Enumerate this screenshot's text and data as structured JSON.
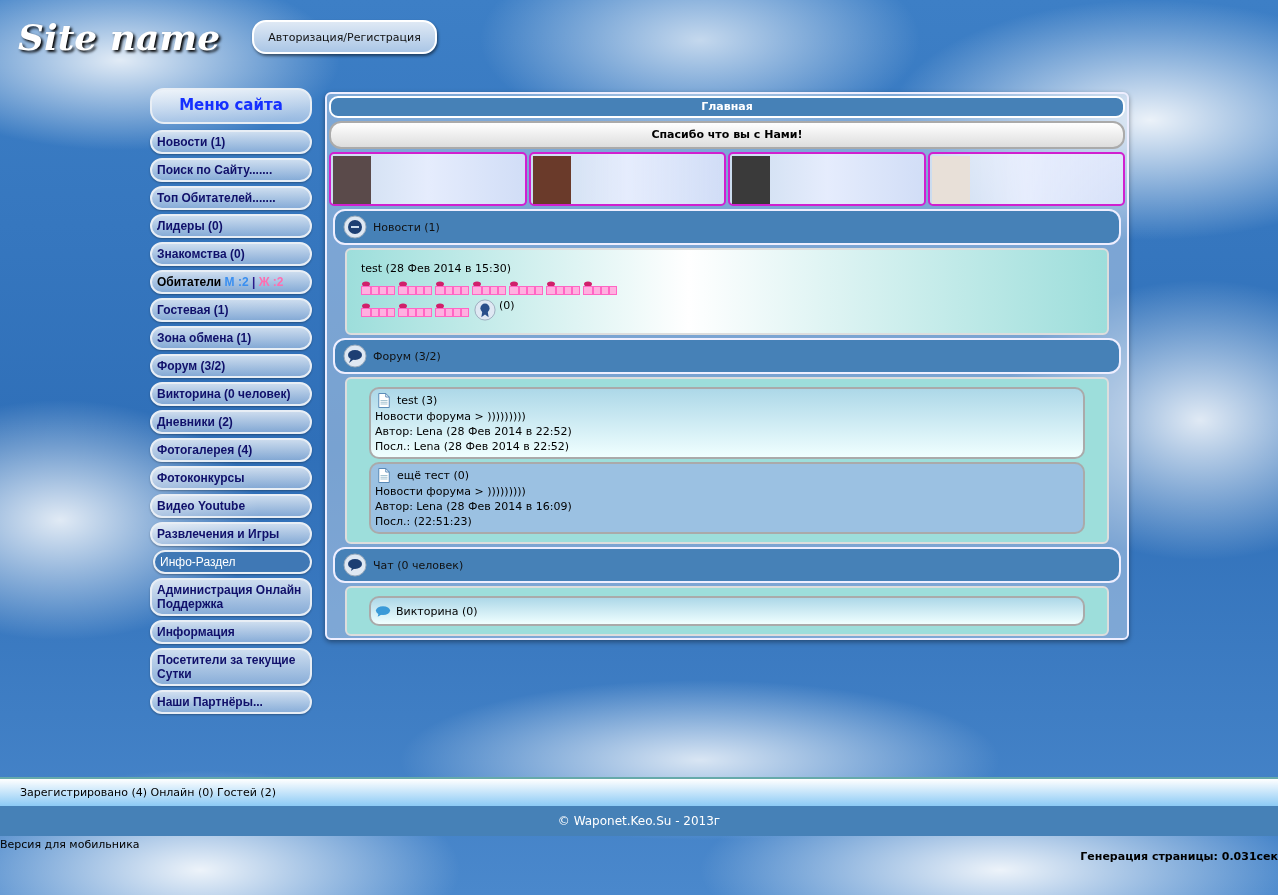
{
  "header": {
    "logo": "Site name",
    "auth_button": "Авторизация/Регистрация"
  },
  "sidebar": {
    "title": "Меню сайта",
    "items": [
      {
        "kind": "link",
        "label": "Новости (1)",
        "selected": false
      },
      {
        "kind": "link",
        "label": "Поиск по Сайту.......",
        "selected": false
      },
      {
        "kind": "link",
        "label": "Топ Обитателей.......",
        "selected": false
      },
      {
        "kind": "link",
        "label": "Лидеры (0)",
        "selected": false
      },
      {
        "kind": "link",
        "label": "Знакомства (0)",
        "selected": false
      },
      {
        "kind": "residents",
        "label": "Обитатели",
        "male": "М :2",
        "separator": "|",
        "female": "Ж :2",
        "selected": false
      },
      {
        "kind": "link",
        "label": "Гостевая (1)",
        "selected": false
      },
      {
        "kind": "link",
        "label": "Зона обмена (1)",
        "selected": false
      },
      {
        "kind": "link",
        "label": "Форум (3/2)",
        "selected": false
      },
      {
        "kind": "link",
        "label": "Викторина (0 человек)",
        "selected": false
      },
      {
        "kind": "link",
        "label": "Дневники (2)",
        "selected": false
      },
      {
        "kind": "link",
        "label": "Фотогалерея (4)",
        "selected": false
      },
      {
        "kind": "link",
        "label": "Фотоконкурсы",
        "selected": false
      },
      {
        "kind": "link",
        "label": "Видео Youtube",
        "selected": false
      },
      {
        "kind": "link",
        "label": "Развлечения и Игры",
        "selected": false
      },
      {
        "kind": "link",
        "label": "Инфо-Раздел",
        "selected": true
      },
      {
        "kind": "link",
        "label": "Администрация Онлайн Поддержка",
        "selected": false
      },
      {
        "kind": "link",
        "label": "Информация",
        "selected": false
      },
      {
        "kind": "link",
        "label": "Посетители за текущие Сутки",
        "selected": false
      },
      {
        "kind": "link",
        "label": "Наши Партнёры...",
        "selected": false
      }
    ]
  },
  "main": {
    "title": "Главная",
    "welcome": "Спасибо что вы с Нами!",
    "news": {
      "heading": "Новости (1)",
      "entry": "test (28 Фев 2014 в 15:30)",
      "reactions": "(0)"
    },
    "forum": {
      "heading": "Форум (3/2)",
      "topics": [
        {
          "title": "test (3)",
          "lines": [
            "Новости форума > )))))))))",
            "Автор: Lena (28 Фев 2014 в 22:52)",
            "Посл.: Lena (28 Фев 2014 в 22:52)"
          ],
          "highlighted": false
        },
        {
          "title": "ещё тест (0)",
          "lines": [
            "Новости форума > )))))))))",
            "Автор: Lena (28 Фев 2014 в 16:09)",
            "Посл.: (22:51:23)"
          ],
          "highlighted": true
        }
      ]
    },
    "chat": {
      "heading": "Чат (0 человек)",
      "rooms": [
        "Викторина (0)"
      ]
    }
  },
  "status_bar": "Зарегистрировано (4) Онлайн (0) Гостей (2)",
  "copyright": "© Waponet.Keo.Su - 2013г",
  "mobile_link": "Версия для мобильника",
  "generation": "Генерация страницы: 0.031сек"
}
